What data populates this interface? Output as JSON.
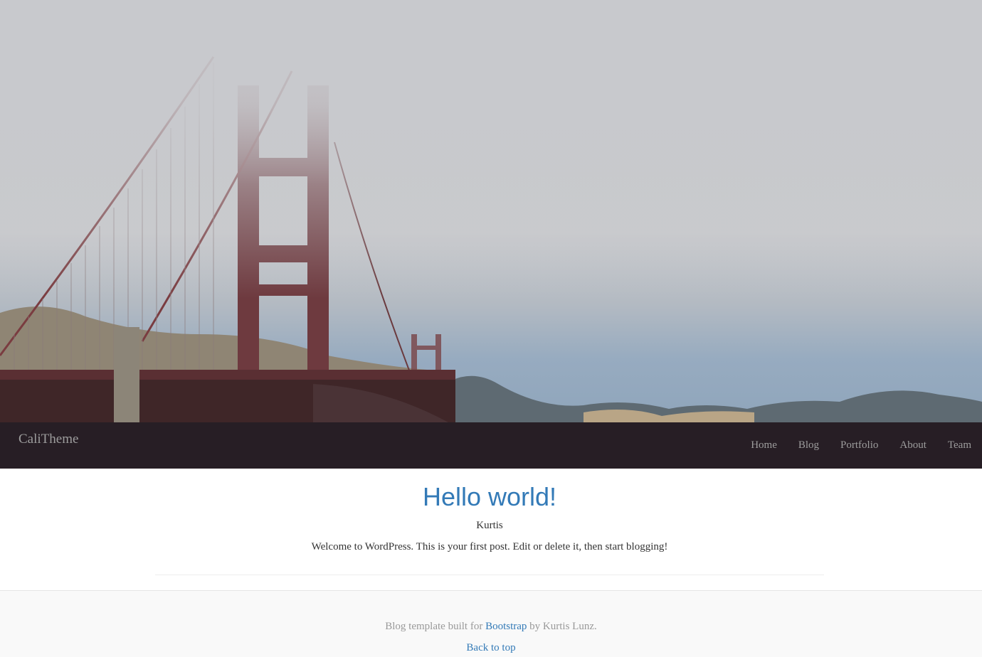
{
  "hero": {
    "image_description_icon": "golden-gate-bridge-fog-photo"
  },
  "navbar": {
    "brand": "CaliTheme",
    "items": [
      {
        "label": "Home"
      },
      {
        "label": "Blog"
      },
      {
        "label": "Portfolio"
      },
      {
        "label": "About"
      },
      {
        "label": "Team"
      }
    ]
  },
  "post": {
    "title": "Hello world!",
    "author": "Kurtis",
    "excerpt": "Welcome to WordPress. This is your first post. Edit or delete it, then start blogging!"
  },
  "footer": {
    "prefix": "Blog template built for ",
    "bootstrap_link": "Bootstrap",
    "suffix": " by Kurtis Lunz.",
    "back_to_top": "Back to top"
  },
  "colors": {
    "navbar_bg": "#271e25",
    "link": "#337ab7",
    "nav_text": "#9d9d9d"
  }
}
